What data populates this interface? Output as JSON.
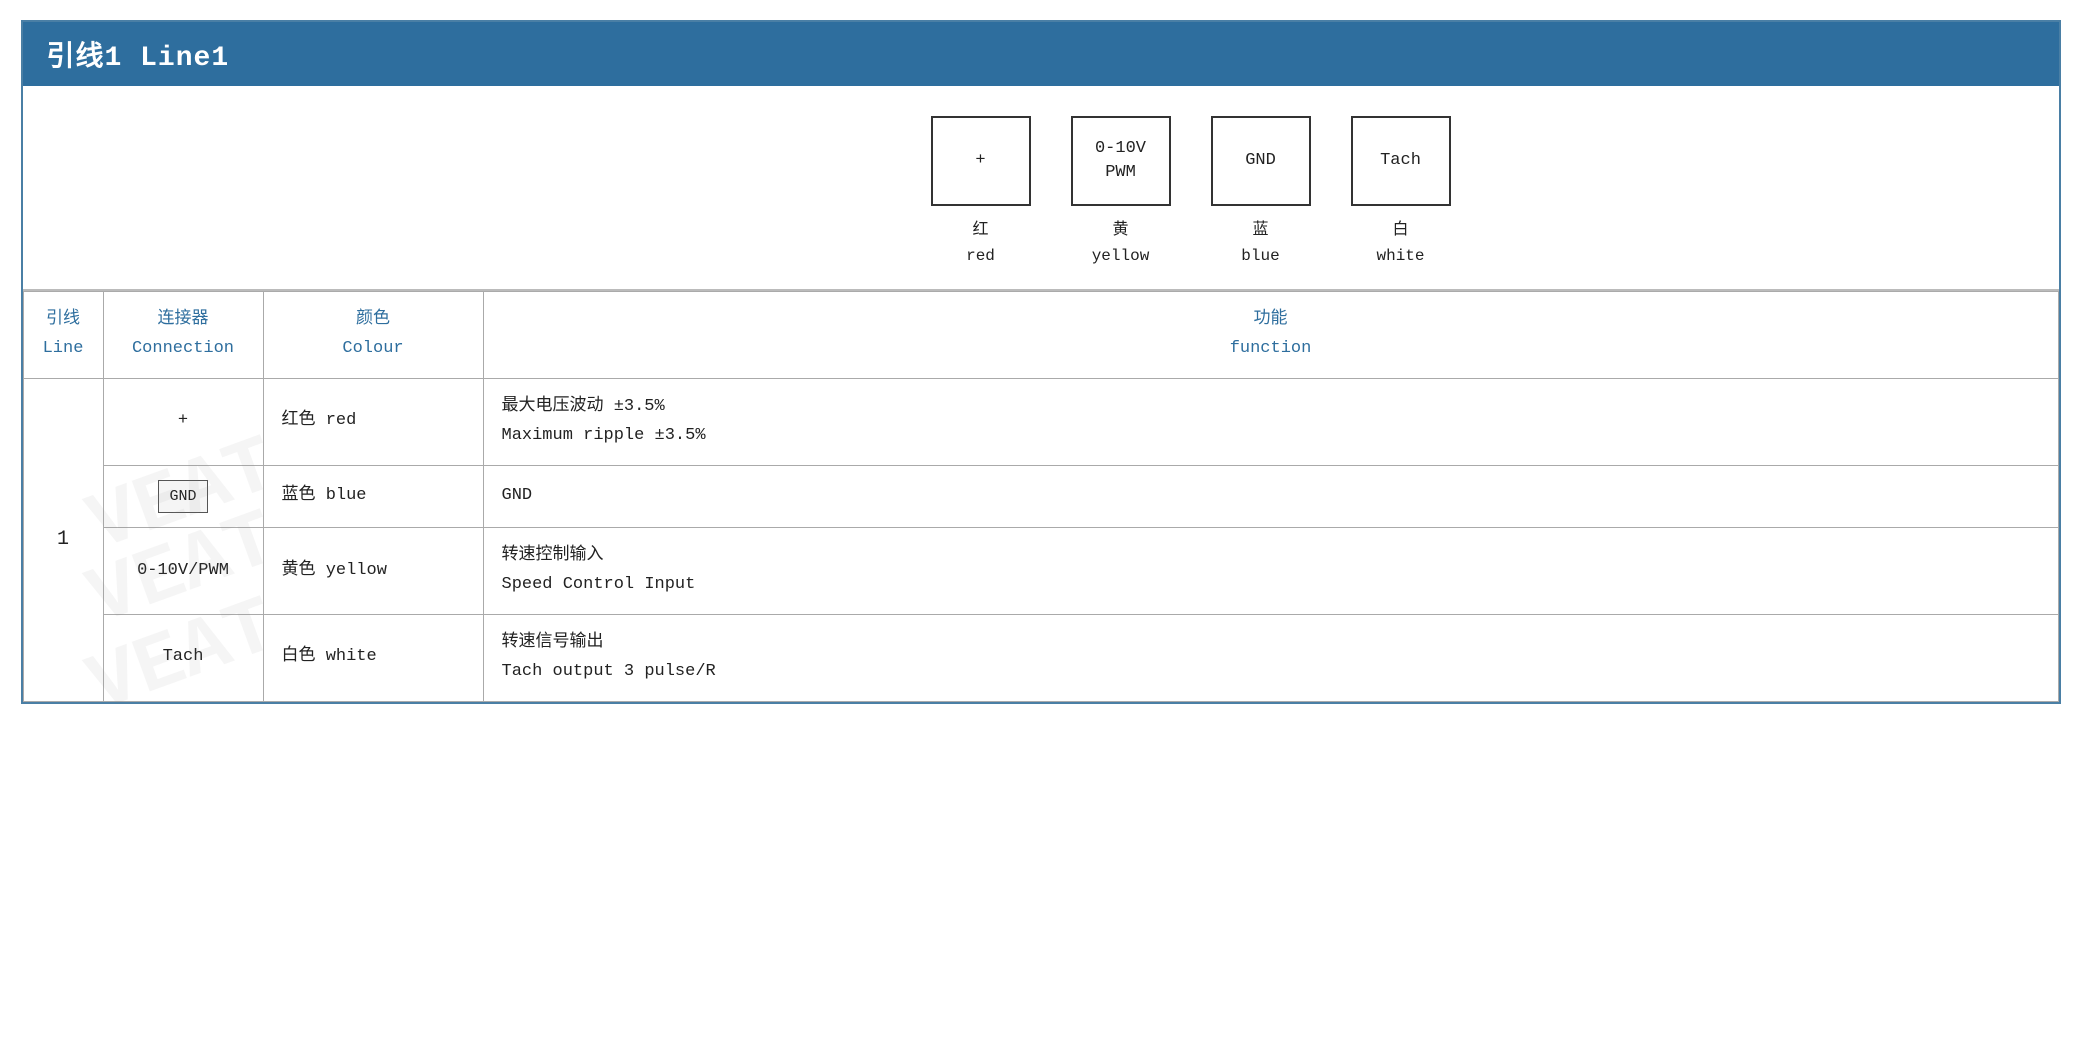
{
  "title": "引线1 Line1",
  "diagram": {
    "pins": [
      {
        "id": "plus",
        "label": "+",
        "chinese": "红",
        "english": "red"
      },
      {
        "id": "pwm",
        "label": "0-10V\nPWM",
        "chinese": "黄",
        "english": "yellow"
      },
      {
        "id": "gnd",
        "label": "GND",
        "chinese": "蓝",
        "english": "blue"
      },
      {
        "id": "tach",
        "label": "Tach",
        "chinese": "白",
        "english": "white"
      }
    ]
  },
  "table": {
    "headers": {
      "line_zh": "引线",
      "line_en": "Line",
      "conn_zh": "连接器",
      "conn_en": "Connection",
      "colour_zh": "颜色",
      "colour_en": "Colour",
      "func_zh": "功能",
      "func_en": "function"
    },
    "rows": [
      {
        "line": "1",
        "connection": "+",
        "colour_zh": "红色",
        "colour_en": "red",
        "func_zh": "最大电压波动 ±3.5%",
        "func_en": "Maximum ripple ±3.5%"
      },
      {
        "line": "",
        "connection": "GND",
        "colour_zh": "蓝色",
        "colour_en": "blue",
        "func_zh": "GND",
        "func_en": ""
      },
      {
        "line": "",
        "connection": "0-10V/PWM",
        "colour_zh": "黄色",
        "colour_en": "yellow",
        "func_zh": "转速控制输入",
        "func_en": "Speed Control Input"
      },
      {
        "line": "",
        "connection": "Tach",
        "colour_zh": "白色",
        "colour_en": "white",
        "func_zh": "转速信号输出",
        "func_en": "Tach output 3 pulse/R"
      }
    ]
  },
  "watermark_text": "VEAT"
}
